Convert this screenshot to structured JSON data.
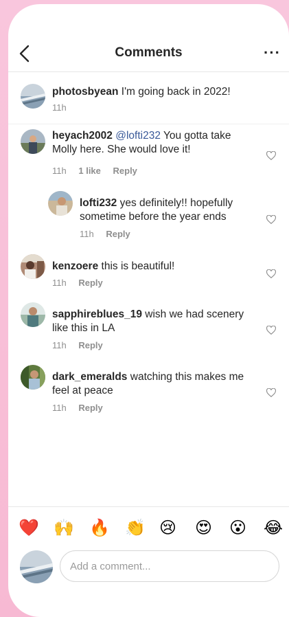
{
  "header": {
    "title": "Comments",
    "more_label": "···"
  },
  "caption": {
    "username": "photosbyean",
    "text": "I'm going back in 2022!",
    "time": "11h"
  },
  "comments": [
    {
      "username": "heyach2002",
      "mention": "@lofti232",
      "text": "You gotta take Molly here. She would love it!",
      "time": "11h",
      "likes": "1 like",
      "reply": "Reply"
    },
    {
      "username": "lofti232",
      "text": "yes definitely!! hopefully sometime before the year ends",
      "time": "11h",
      "reply": "Reply"
    },
    {
      "username": "kenzoere",
      "text": "this is beautiful!",
      "time": "11h",
      "reply": "Reply"
    },
    {
      "username": "sapphireblues_19",
      "text": "wish we had scenery like this in LA",
      "time": "11h",
      "reply": "Reply"
    },
    {
      "username": "dark_emeralds",
      "text": "watching this makes me feel at peace",
      "time": "11h",
      "reply": "Reply"
    }
  ],
  "emojis": [
    "❤️",
    "🙌",
    "🔥",
    "👏",
    "😢",
    "😍",
    "😮",
    "😂"
  ],
  "input": {
    "placeholder": "Add a comment..."
  }
}
